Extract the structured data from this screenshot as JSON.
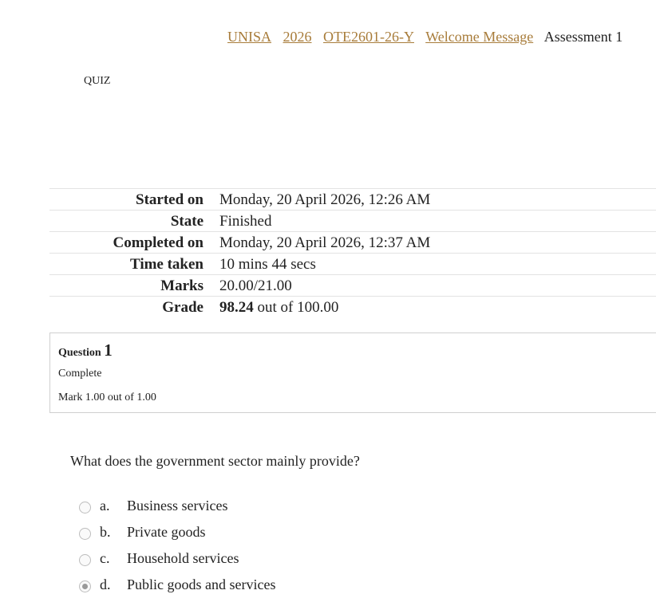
{
  "breadcrumb": {
    "items": [
      "UNISA",
      "2026",
      "OTE2601-26-Y",
      "Welcome Message"
    ],
    "current": "Assessment 1"
  },
  "quiz_label": "QUIZ",
  "summary": {
    "started_on": {
      "label": "Started on",
      "value": "Monday, 20 April 2026, 12:26 AM"
    },
    "state": {
      "label": "State",
      "value": "Finished"
    },
    "completed_on": {
      "label": "Completed on",
      "value": "Monday, 20 April 2026, 12:37 AM"
    },
    "time_taken": {
      "label": "Time taken",
      "value": "10 mins 44 secs"
    },
    "marks": {
      "label": "Marks",
      "value": "20.00/21.00"
    },
    "grade": {
      "label": "Grade",
      "value_bold": "98.24",
      "value_rest": " out of 100.00"
    }
  },
  "question": {
    "label": "Question",
    "number": "1",
    "state": "Complete",
    "mark": "Mark 1.00 out of 1.00",
    "text": "What does the government sector mainly provide?",
    "answers": [
      {
        "letter": "a.",
        "text": "Business services",
        "selected": false
      },
      {
        "letter": "b.",
        "text": "Private goods",
        "selected": false
      },
      {
        "letter": "c.",
        "text": "Household services",
        "selected": false
      },
      {
        "letter": "d.",
        "text": "Public goods and services",
        "selected": true
      }
    ]
  },
  "colors": {
    "link": "#a87c3a",
    "border": "#cfcfcf"
  }
}
